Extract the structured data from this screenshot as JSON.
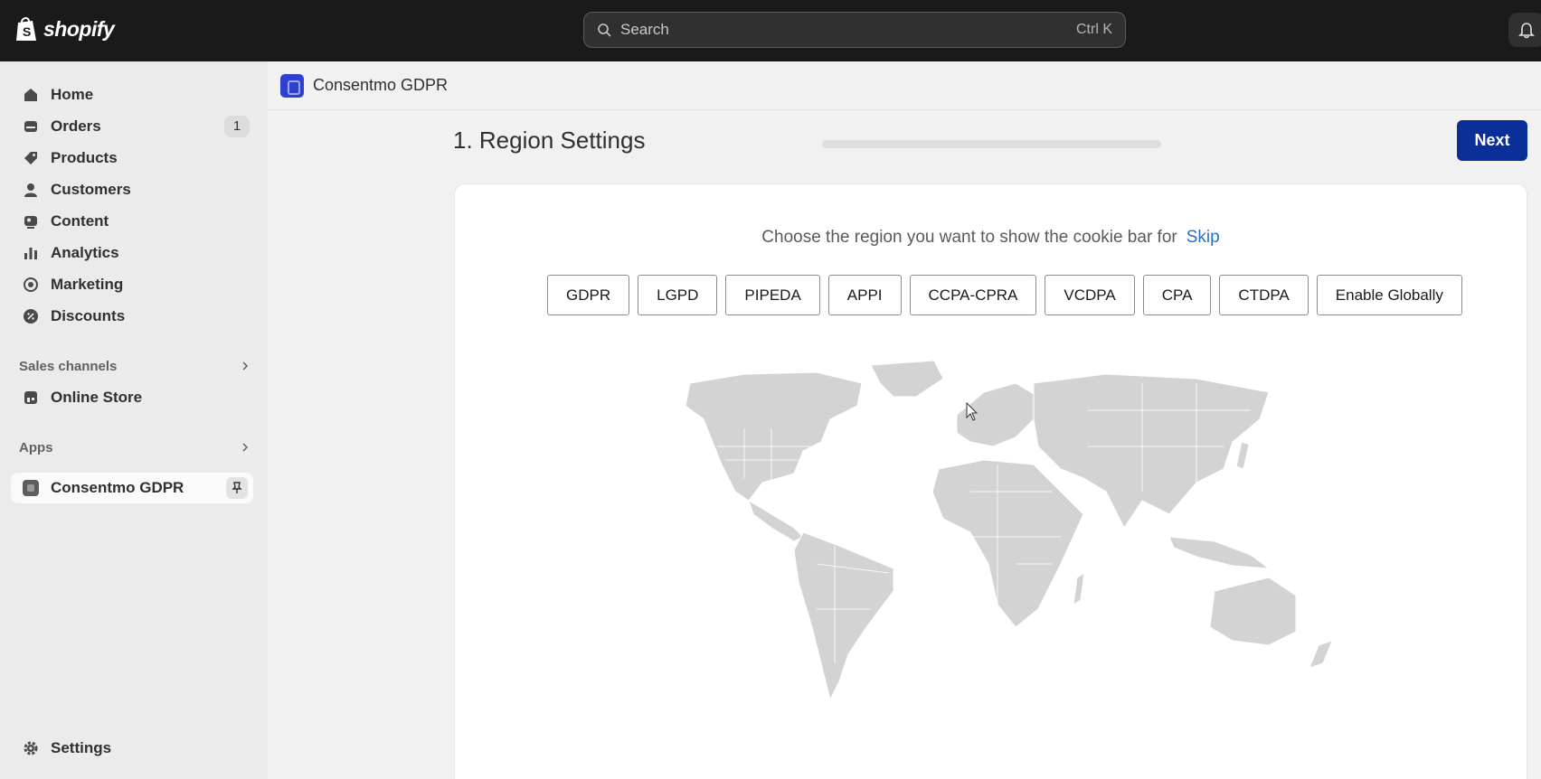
{
  "topbar": {
    "logo_text": "shopify",
    "search_placeholder": "Search",
    "search_shortcut": "Ctrl K"
  },
  "sidebar": {
    "items": [
      {
        "label": "Home",
        "icon": "home-icon"
      },
      {
        "label": "Orders",
        "icon": "orders-icon",
        "badge": "1"
      },
      {
        "label": "Products",
        "icon": "tag-icon"
      },
      {
        "label": "Customers",
        "icon": "person-icon"
      },
      {
        "label": "Content",
        "icon": "content-icon"
      },
      {
        "label": "Analytics",
        "icon": "bar-chart-icon"
      },
      {
        "label": "Marketing",
        "icon": "target-icon"
      },
      {
        "label": "Discounts",
        "icon": "discount-icon"
      }
    ],
    "sales_channels": {
      "label": "Sales channels",
      "items": [
        {
          "label": "Online Store",
          "icon": "store-icon"
        }
      ]
    },
    "apps": {
      "label": "Apps",
      "items": [
        {
          "label": "Consentmo GDPR",
          "icon": "app-icon"
        }
      ]
    },
    "settings": {
      "label": "Settings",
      "icon": "gear-icon"
    }
  },
  "app_header": {
    "title": "Consentmo GDPR"
  },
  "page": {
    "title": "1. Region Settings",
    "progress": 0,
    "next_label": "Next"
  },
  "card": {
    "prompt": "Choose the region you want to show the cookie bar for",
    "skip_label": "Skip",
    "regions": [
      "GDPR",
      "LGPD",
      "PIPEDA",
      "APPI",
      "CCPA-CPRA",
      "VCDPA",
      "CPA",
      "CTDPA",
      "Enable Globally"
    ]
  },
  "colors": {
    "topbar": "#1a1a1a",
    "accent": "#0a2f99",
    "link": "#2c6ecb",
    "map_land": "#d3d3d3"
  }
}
